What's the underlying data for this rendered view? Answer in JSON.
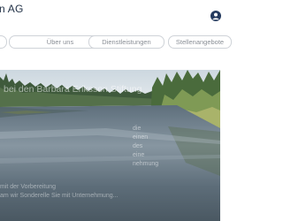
{
  "header": {
    "brand": "n AG",
    "icon": "user-icon"
  },
  "nav": {
    "items": [
      {
        "label": ""
      },
      {
        "label": "Über uns"
      },
      {
        "label": "Dienstleistungen"
      },
      {
        "label": "Stellenangebote"
      }
    ]
  },
  "hero": {
    "title": "bei den Barbara Eriksson Stiftung",
    "paragraph_lines": [
      "die",
      "einen",
      "des",
      "eine",
      "nehmung"
    ],
    "bottom_lines": [
      "mit der Vorbereitung",
      "am wir Sonderelle Sie mit Unternehmung..."
    ]
  },
  "colors": {
    "brand_text": "#1f2f45",
    "pill_border": "#cfd3d8",
    "pill_text": "#8a8f96"
  }
}
